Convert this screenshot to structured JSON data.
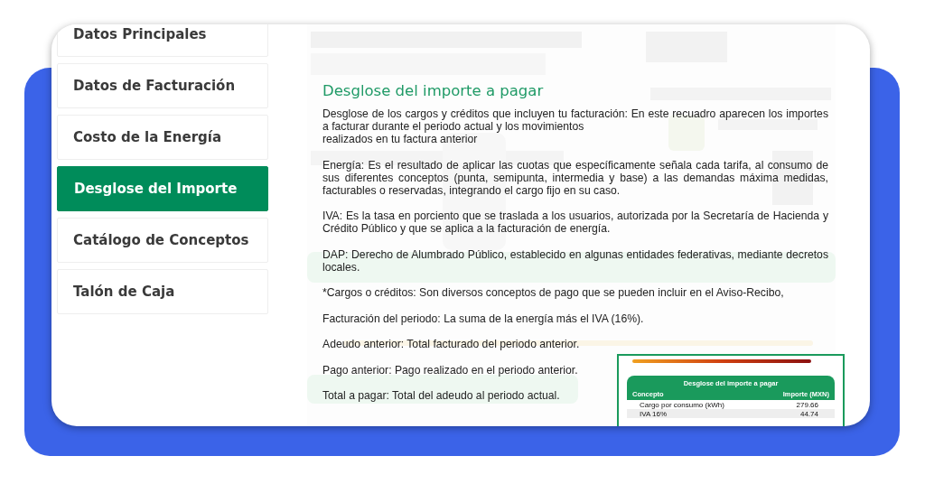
{
  "sidebar": {
    "items": [
      {
        "label": "Datos Principales",
        "selected": false
      },
      {
        "label": "Datos de Facturación",
        "selected": false
      },
      {
        "label": "Costo de la Energía",
        "selected": false
      },
      {
        "label": "Desglose del Importe",
        "selected": true
      },
      {
        "label": "Catálogo de Conceptos",
        "selected": false
      },
      {
        "label": "Talón de Caja",
        "selected": false
      }
    ]
  },
  "content": {
    "title": "Desglose del importe a pagar",
    "paragraphs": [
      "Desglose de los cargos y créditos que incluyen tu facturación: En este recuadro aparecen los importes a facturar durante el periodo actual y los movimientos\nrealizados en tu factura anterior",
      "Energía: Es el resultado de aplicar las cuotas que específicamente señala cada tarifa, al consumo de sus diferentes conceptos (punta, semipunta, intermedia y base) a las demandas máxima medidas, facturables o reservadas, integrando el cargo fijo en su caso.",
      "IVA: Es la tasa en porciento que se traslada a los usuarios, autorizada por la Secretaría de Hacienda y Crédito Público y que se aplica a la facturación de energía.",
      "DAP: Derecho de Alumbrado Público, establecido en algunas entidades federativas, mediante decretos locales.",
      "*Cargos o créditos: Son diversos conceptos de pago que se pueden incluir en el Aviso-Recibo,",
      "Facturación del periodo: La suma de la energía más el IVA (16%).",
      "Adeudo anterior: Total facturado del periodo anterior.",
      "Pago anterior: Pago realizado en el periodo anterior.",
      "Total a pagar: Total del adeudo al periodo actual."
    ]
  },
  "inset": {
    "title": "Desglose del importe a pagar",
    "columns": [
      "Concepto",
      "Importe (MXN)"
    ],
    "rows": [
      {
        "concept": "Cargo por consumo (kWh)",
        "amount": "279.66",
        "shaded": false
      },
      {
        "concept": "IVA 16%",
        "amount": "44.74",
        "shaded": true
      }
    ]
  }
}
